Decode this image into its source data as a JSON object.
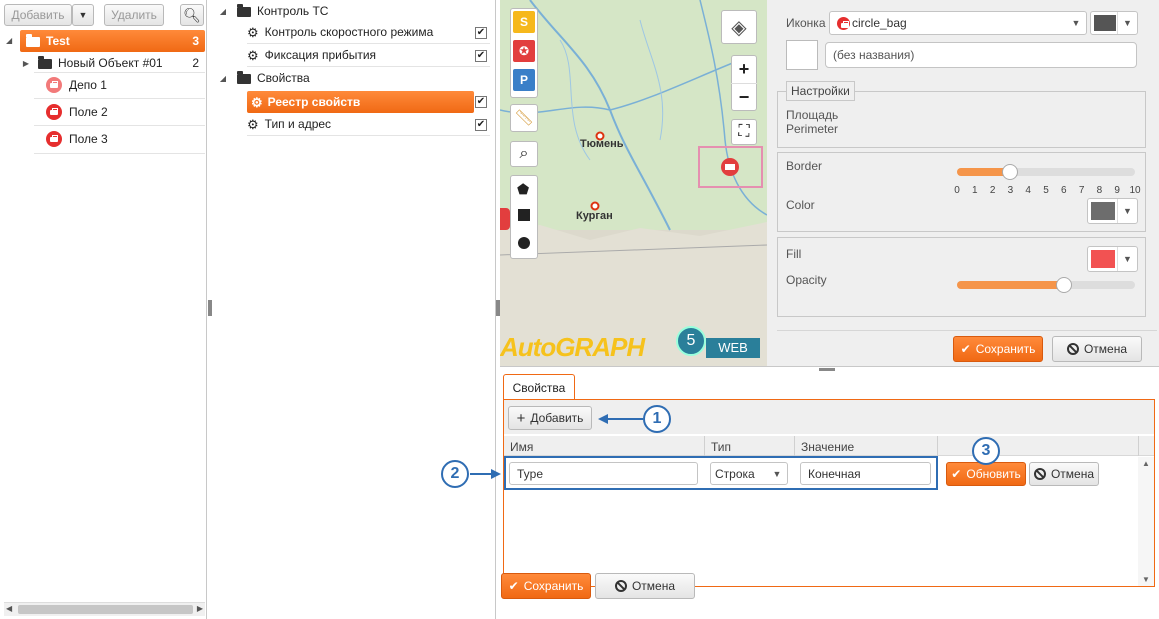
{
  "left_panel": {
    "toolbar": {
      "add_label": "Добавить",
      "delete_label": "Удалить"
    },
    "tree": [
      {
        "label": "Test",
        "count": "3",
        "selected": true
      },
      {
        "label": "Новый Объект #01",
        "count": "2"
      },
      {
        "label": "Депо 1"
      },
      {
        "label": "Поле 2"
      },
      {
        "label": "Поле 3"
      }
    ]
  },
  "middle_panel": {
    "items": [
      {
        "label": "Контроль ТС",
        "type": "folder"
      },
      {
        "label": "Контроль скоростного режима",
        "checked": true
      },
      {
        "label": "Фиксация прибытия",
        "checked": true
      },
      {
        "label": "Свойства",
        "type": "folder"
      },
      {
        "label": "Реестр свойств",
        "checked": true,
        "selected": true
      },
      {
        "label": "Тип и адрес",
        "checked": true
      }
    ]
  },
  "map": {
    "cities": [
      "Тюмень",
      "Курган"
    ],
    "logo_text": "AutoGRAPH",
    "logo_version": "5",
    "logo_web": "WEB",
    "zoom_in": "+",
    "zoom_out": "−"
  },
  "style_panel": {
    "icon_label": "Иконка",
    "icon_value": "circle_bag",
    "name_placeholder": "(без названия)",
    "settings_legend": "Настройки",
    "area_label": "Площадь",
    "perimeter_label": "Perimeter",
    "border_label": "Border",
    "border_value": 3,
    "border_ticks": [
      "0",
      "1",
      "2",
      "3",
      "4",
      "5",
      "6",
      "7",
      "8",
      "9",
      "10"
    ],
    "color_label": "Color",
    "color_value": "#6d6d6d",
    "fill_label": "Fill",
    "fill_value": "#f25252",
    "opacity_label": "Opacity",
    "opacity_fraction": 0.6,
    "save_label": "Сохранить",
    "cancel_label": "Отмена"
  },
  "properties": {
    "tab_label": "Свойства",
    "add_label": "Добавить",
    "columns": [
      "Имя",
      "Тип",
      "Значение"
    ],
    "row": {
      "name": "Type",
      "type": "Строка",
      "value": "Конечная"
    },
    "update_label": "Обновить",
    "row_cancel_label": "Отмена",
    "save_label": "Сохранить",
    "cancel_label": "Отмена"
  },
  "callouts": [
    "1",
    "2",
    "3"
  ],
  "colors": {
    "accent": "#f06914",
    "callout": "#2f6db3"
  }
}
